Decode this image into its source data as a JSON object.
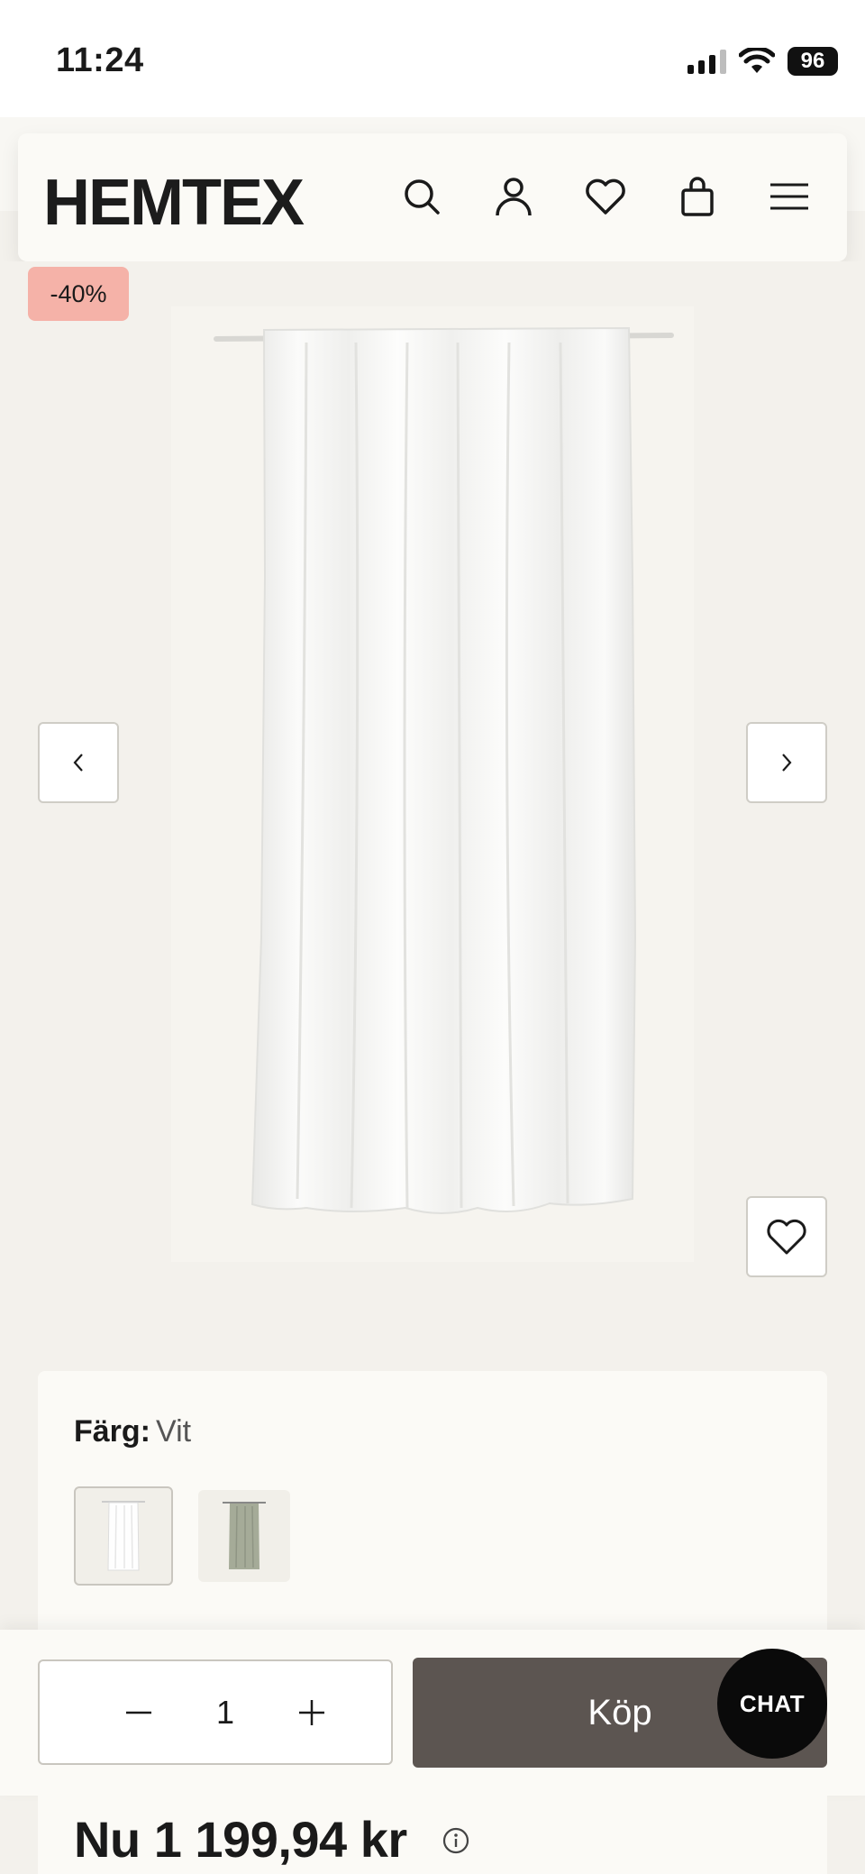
{
  "status_bar": {
    "time": "11:24",
    "battery": "96"
  },
  "header": {
    "logo": "HEMTEX",
    "icons": [
      "search-icon",
      "account-icon",
      "heart-icon",
      "bag-icon",
      "menu-icon"
    ]
  },
  "product": {
    "discount_badge": "-40%",
    "image": "white-curtain-panel",
    "color_label": "Färg:",
    "color_value": "Vit",
    "swatches": [
      {
        "name": "white",
        "color": "#f4f3f0"
      },
      {
        "name": "sage-green",
        "color": "#a5ab98"
      }
    ]
  },
  "purchase": {
    "quantity": "1",
    "buy_label": "Köp",
    "chat_label": "CHAT",
    "price": "Nu 1 199,94 kr"
  },
  "colors": {
    "discount": "#f5b2a8",
    "buy_button": "#5c5551",
    "chat_button": "#0a0a0a",
    "background": "#f3f1ec"
  }
}
